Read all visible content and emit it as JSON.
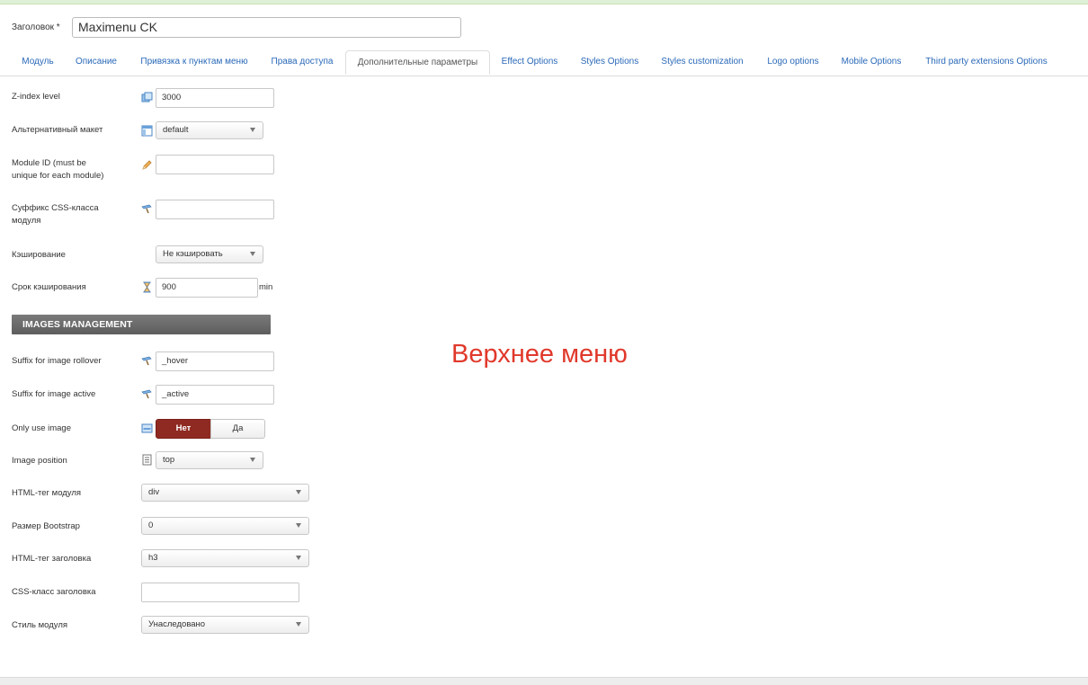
{
  "title_field": {
    "label": "Заголовок *",
    "value": "Maximenu CK"
  },
  "tabs": [
    {
      "label": "Модуль"
    },
    {
      "label": "Описание"
    },
    {
      "label": "Привязка к пунктам меню"
    },
    {
      "label": "Права доступа"
    },
    {
      "label": "Дополнительные параметры",
      "active": true
    },
    {
      "label": "Effect Options"
    },
    {
      "label": "Styles Options"
    },
    {
      "label": "Styles customization"
    },
    {
      "label": "Logo options"
    },
    {
      "label": "Mobile Options"
    },
    {
      "label": "Third party extensions Options"
    }
  ],
  "fields": {
    "zindex": {
      "label": "Z-index level",
      "value": "3000",
      "icon": "layers-icon"
    },
    "layout": {
      "label": "Альтернативный макет",
      "value": "default",
      "icon": "layout-icon"
    },
    "module_id": {
      "label_line1": "Module ID (must be",
      "label_line2": "unique for each module)",
      "value": "",
      "icon": "pencil-icon"
    },
    "css_suffix": {
      "label_line1": "Суффикс CSS-класса",
      "label_line2": "модуля",
      "value": "",
      "icon": "brush-icon"
    },
    "caching": {
      "label": "Кэширование",
      "value": "Не кэшировать"
    },
    "cache_time": {
      "label": "Срок кэширования",
      "value": "900",
      "unit": "min",
      "icon": "hourglass-icon"
    },
    "rollover_suffix": {
      "label": "Suffix for image rollover",
      "value": "_hover",
      "icon": "brush-icon"
    },
    "active_suffix": {
      "label": "Suffix for image active",
      "value": "_active",
      "icon": "brush-icon"
    },
    "only_image": {
      "label": "Only use image",
      "no": "Нет",
      "yes": "Да",
      "selected": "Нет",
      "icon": "image-icon"
    },
    "image_position": {
      "label": "Image position",
      "value": "top",
      "icon": "list-icon"
    },
    "html_tag": {
      "label": "HTML-тег модуля",
      "value": "div"
    },
    "bootstrap_size": {
      "label": "Размер Bootstrap",
      "value": "0"
    },
    "header_tag": {
      "label": "HTML-тег заголовка",
      "value": "h3"
    },
    "header_class": {
      "label": "CSS-класс заголовка",
      "value": ""
    },
    "module_style": {
      "label": "Стиль модуля",
      "value": "Унаследовано"
    }
  },
  "section_images": "IMAGES MANAGEMENT",
  "annotation": "Верхнее меню",
  "colors": {
    "active_toggle": "#8f2a22",
    "link": "#2a69b8",
    "annotation": "#e0392b"
  }
}
